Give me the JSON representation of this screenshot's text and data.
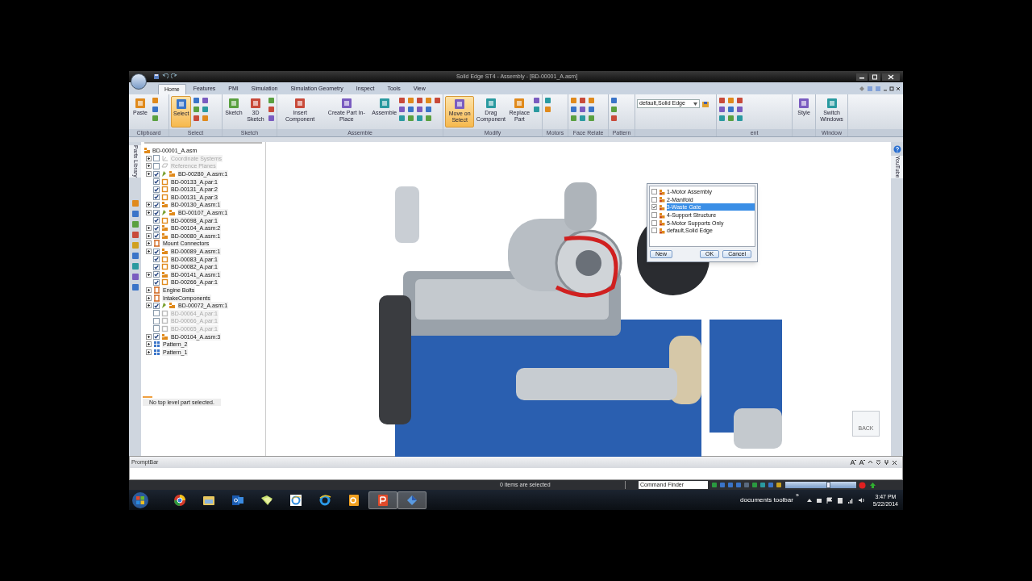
{
  "window": {
    "title": "Solid Edge ST4 - Assembly - [BD-00001_A.asm]"
  },
  "tabs": [
    {
      "label": "Home",
      "selected": true
    },
    {
      "label": "Features",
      "selected": false
    },
    {
      "label": "PMI",
      "selected": false
    },
    {
      "label": "Simulation",
      "selected": false
    },
    {
      "label": "Simulation Geometry",
      "selected": false
    },
    {
      "label": "Inspect",
      "selected": false
    },
    {
      "label": "Tools",
      "selected": false
    },
    {
      "label": "View",
      "selected": false
    }
  ],
  "ribbon": [
    {
      "kind": "tools",
      "label": "Clipboard",
      "buttons": [
        {
          "label": "Paste",
          "selected": false
        }
      ]
    },
    {
      "kind": "tools",
      "label": "Select",
      "buttons": [
        {
          "label": "Select",
          "selected": true
        }
      ]
    },
    {
      "kind": "tools",
      "label": "Sketch",
      "buttons": [
        {
          "label": "Sketch",
          "selected": false
        },
        {
          "label": "3D Sketch",
          "selected": false
        }
      ]
    },
    {
      "kind": "tools",
      "label": "Assemble",
      "buttons": [
        {
          "label": "Insert Component",
          "selected": false
        },
        {
          "label": "Create Part In-Place",
          "selected": false
        },
        {
          "label": "Assemble",
          "selected": false
        }
      ]
    },
    {
      "kind": "tools",
      "label": "Modify",
      "buttons": [
        {
          "label": "Move on Select",
          "selected": true
        },
        {
          "label": "Drag Component",
          "selected": false
        },
        {
          "label": "Replace Part",
          "selected": false
        }
      ]
    },
    {
      "kind": "tools",
      "label": "Motors"
    },
    {
      "kind": "tools",
      "label": "Face Relate"
    },
    {
      "kind": "tools",
      "label": "Pattern"
    },
    {
      "kind": "combo",
      "value": "default,Solid Edge"
    },
    {
      "kind": "tools",
      "label": "ent"
    },
    {
      "kind": "tools",
      "buttons": [
        {
          "label": "Style",
          "selected": false
        }
      ]
    },
    {
      "kind": "tools",
      "label": "Window",
      "buttons": [
        {
          "label": "Switch Windows",
          "selected": false
        }
      ]
    }
  ],
  "side_tab": {
    "label": "Parts Library"
  },
  "tree": {
    "label": "BD-00001_A.asm",
    "children": [
      {
        "label": "Coordinate Systems",
        "kind": "coord",
        "expandable": true,
        "checked": false,
        "disabled": true,
        "pinned": false
      },
      {
        "label": "Reference Planes",
        "kind": "plane",
        "expandable": true,
        "checked": false,
        "disabled": true,
        "pinned": false
      },
      {
        "label": "BD-00280_A.asm:1",
        "kind": "asm",
        "expandable": true,
        "checked": true,
        "disabled": false,
        "pinned": true
      },
      {
        "label": "BD-00133_A.par:1",
        "kind": "par",
        "expandable": false,
        "checked": true,
        "disabled": false,
        "pinned": false
      },
      {
        "label": "BD-00131_A.par:2",
        "kind": "par",
        "expandable": false,
        "checked": true,
        "disabled": false,
        "pinned": false
      },
      {
        "label": "BD-00131_A.par:3",
        "kind": "par",
        "expandable": false,
        "checked": true,
        "disabled": false,
        "pinned": false
      },
      {
        "label": "BD-00130_A.asm:1",
        "kind": "asm",
        "expandable": true,
        "checked": true,
        "disabled": false,
        "pinned": false
      },
      {
        "label": "BD-00107_A.asm:1",
        "kind": "asm",
        "expandable": true,
        "checked": true,
        "disabled": false,
        "pinned": true
      },
      {
        "label": "BD-00098_A.par:1",
        "kind": "par",
        "expandable": false,
        "checked": true,
        "disabled": false,
        "pinned": false
      },
      {
        "label": "BD-00104_A.asm:2",
        "kind": "asm",
        "expandable": true,
        "checked": true,
        "disabled": false,
        "pinned": false
      },
      {
        "label": "BD-00080_A.asm:1",
        "kind": "asm",
        "expandable": true,
        "checked": true,
        "disabled": false,
        "pinned": false
      },
      {
        "label": "Mount Connectors",
        "kind": "group",
        "expandable": true
      },
      {
        "label": "BD-00089_A.asm:1",
        "kind": "asm",
        "expandable": true,
        "checked": true,
        "disabled": false,
        "pinned": false
      },
      {
        "label": "BD-00083_A.par:1",
        "kind": "par",
        "expandable": false,
        "checked": true,
        "disabled": false,
        "pinned": false
      },
      {
        "label": "BD-00082_A.par:1",
        "kind": "par",
        "expandable": false,
        "checked": true,
        "disabled": false,
        "pinned": false
      },
      {
        "label": "BD-00141_A.asm:1",
        "kind": "asm",
        "expandable": true,
        "checked": true,
        "disabled": false,
        "pinned": false
      },
      {
        "label": "BD-00266_A.par:1",
        "kind": "par",
        "expandable": false,
        "checked": true,
        "disabled": false,
        "pinned": false
      },
      {
        "label": "Engine Bolts",
        "kind": "group",
        "expandable": true
      },
      {
        "label": "IntakeComponents",
        "kind": "group",
        "expandable": true
      },
      {
        "label": "BD-00072_A.asm:1",
        "kind": "asm",
        "expandable": true,
        "checked": true,
        "disabled": false,
        "pinned": true
      },
      {
        "label": "BD-00064_A.par:1",
        "kind": "par",
        "expandable": false,
        "checked": false,
        "disabled": true,
        "pinned": false
      },
      {
        "label": "BD-00066_A.par:1",
        "kind": "par",
        "expandable": false,
        "checked": false,
        "disabled": true,
        "pinned": false
      },
      {
        "label": "BD-00065_A.par:1",
        "kind": "par",
        "expandable": false,
        "checked": false,
        "disabled": true,
        "pinned": false
      },
      {
        "label": "BD-00104_A.asm:3",
        "kind": "asm",
        "expandable": true,
        "checked": true,
        "disabled": false,
        "pinned": false
      },
      {
        "label": "Pattern_2",
        "kind": "pattern",
        "expandable": true
      },
      {
        "label": "Pattern_1",
        "kind": "pattern",
        "expandable": true
      }
    ]
  },
  "tree_status": "No top level part selected.",
  "config_dialog": {
    "items": [
      {
        "label": "1-Motor Assembly",
        "checked": false,
        "selected": false
      },
      {
        "label": "2-Manifold",
        "checked": false,
        "selected": false
      },
      {
        "label": "3-Waste Gate",
        "checked": true,
        "selected": true
      },
      {
        "label": "4-Support Structure",
        "checked": false,
        "selected": false
      },
      {
        "label": "5-Motor Supports Only",
        "checked": false,
        "selected": false
      },
      {
        "label": "default,Solid Edge",
        "checked": false,
        "selected": false
      }
    ],
    "buttons": [
      "New",
      "OK",
      "Cancel"
    ]
  },
  "right_tab": {
    "label": "YouTube"
  },
  "view_cube": {
    "label": "BACK"
  },
  "prompt_bar": {
    "title": "PromptBar"
  },
  "status_bar": {
    "selection": "0 items are selected",
    "command_finder": {
      "placeholder": "Command Finder"
    },
    "zoom": {
      "level": 0.6
    }
  },
  "taskbar": {
    "apps": [
      {
        "kind": "browser",
        "selected": false
      },
      {
        "kind": "folder",
        "selected": false
      },
      {
        "kind": "mail",
        "selected": false
      },
      {
        "kind": "notes",
        "selected": false
      },
      {
        "kind": "web",
        "selected": false
      },
      {
        "kind": "web2",
        "selected": false
      },
      {
        "kind": "office",
        "selected": false
      },
      {
        "kind": "slides",
        "selected": true
      },
      {
        "kind": "cad",
        "selected": true
      }
    ],
    "toolbar_label": "documents toolbar",
    "toolbar_chevron": "»",
    "time": "3:47 PM",
    "date": "5/22/2014"
  }
}
